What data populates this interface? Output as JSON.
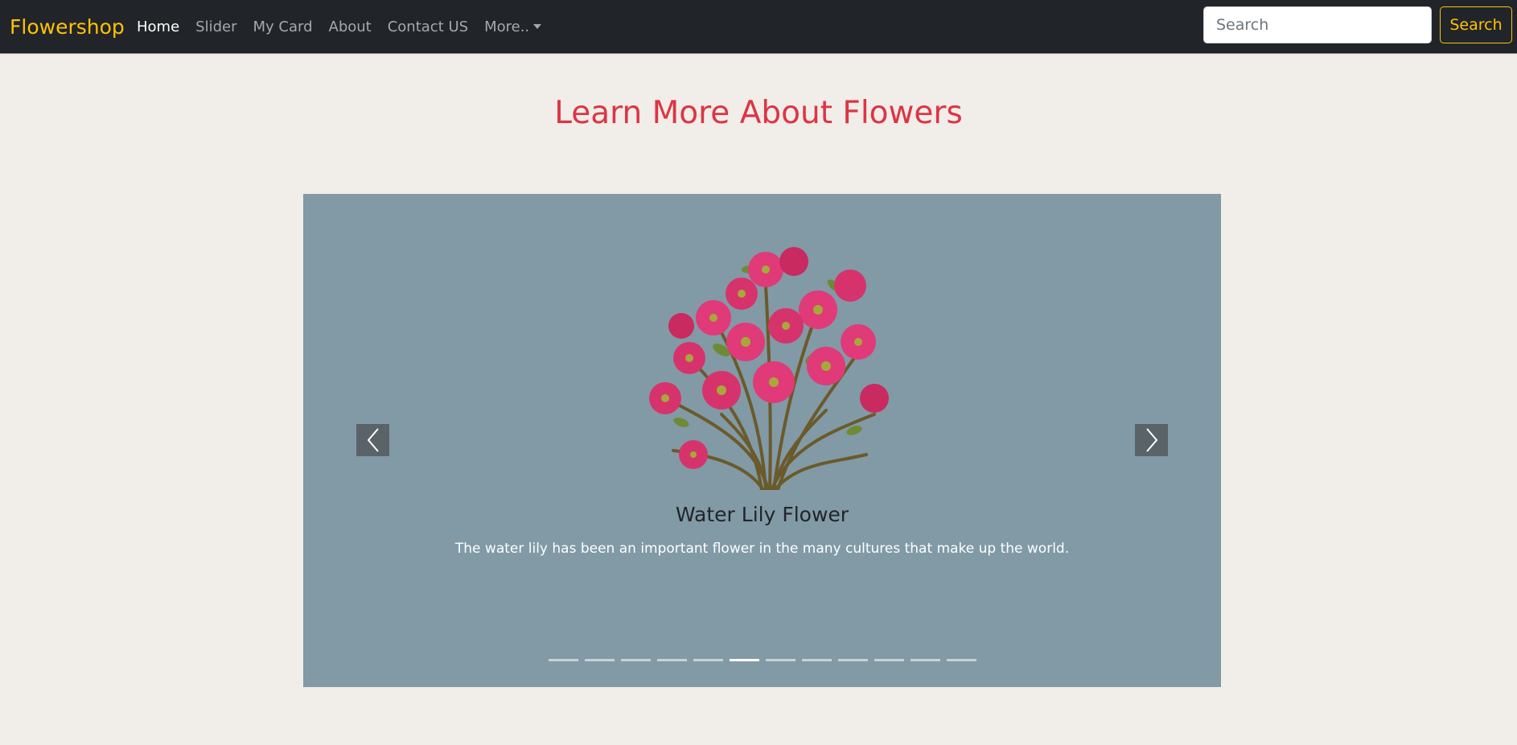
{
  "navbar": {
    "brand": "Flowershop",
    "links": [
      {
        "label": "Home",
        "active": true
      },
      {
        "label": "Slider",
        "active": false
      },
      {
        "label": "My Card",
        "active": false
      },
      {
        "label": "About",
        "active": false
      },
      {
        "label": "Contact US",
        "active": false
      },
      {
        "label": "More..",
        "active": false,
        "dropdown": true
      }
    ],
    "search": {
      "placeholder": "Search",
      "value": "",
      "button_label": "Search"
    }
  },
  "page": {
    "title": "Learn More About Flowers"
  },
  "carousel": {
    "active_index": 5,
    "indicator_count": 12,
    "slide": {
      "image_icon": "flower-bouquet-image",
      "title": "Water Lily Flower",
      "text": "The water lily has been an important flower in the many cultures that make up the world."
    },
    "prev_icon": "chevron-left-icon",
    "next_icon": "chevron-right-icon"
  },
  "colors": {
    "navbar_bg": "#212529",
    "brand": "#ffc107",
    "title": "#dc3545",
    "carousel_bg": "#819aa6",
    "page_bg": "#f1ede8"
  }
}
